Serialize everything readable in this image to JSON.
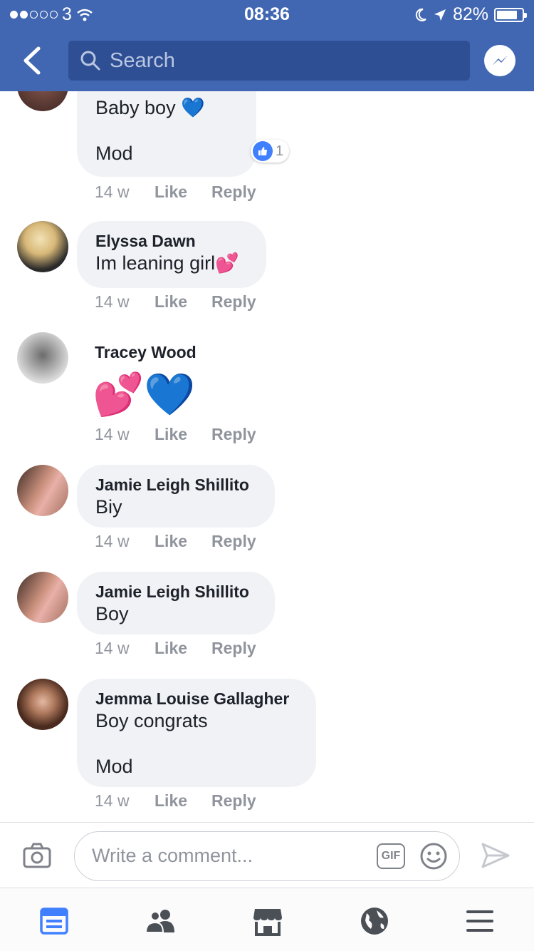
{
  "status_bar": {
    "carrier": "3",
    "time": "08:36",
    "battery": "82%",
    "battery_level": 0.82,
    "signal_bars_filled": 2,
    "signal_bars_total": 5
  },
  "header": {
    "search_placeholder": "Search",
    "accent_color": "#4267b2"
  },
  "comments": [
    {
      "name": "",
      "lines": [
        "Baby boy 💙",
        "",
        "Mod"
      ],
      "time": "14 w",
      "like_label": "Like",
      "reply_label": "Reply",
      "like_count": "1"
    },
    {
      "name": "Elyssa Dawn",
      "lines": [
        "Im leaning girl💕"
      ],
      "time": "14 w",
      "like_label": "Like",
      "reply_label": "Reply"
    },
    {
      "name": "Tracey Wood",
      "lines": [
        "💕💙"
      ],
      "time": "14 w",
      "like_label": "Like",
      "reply_label": "Reply"
    },
    {
      "name": "Jamie Leigh Shillito",
      "lines": [
        "Biy"
      ],
      "time": "14 w",
      "like_label": "Like",
      "reply_label": "Reply"
    },
    {
      "name": "Jamie Leigh Shillito",
      "lines": [
        "Boy"
      ],
      "time": "14 w",
      "like_label": "Like",
      "reply_label": "Reply"
    },
    {
      "name": "Jemma Louise Gallagher",
      "lines": [
        "Boy congrats",
        "",
        "Mod"
      ],
      "time": "14 w",
      "like_label": "Like",
      "reply_label": "Reply"
    }
  ],
  "composer": {
    "placeholder": "Write a comment...",
    "gif_label": "GIF"
  },
  "bottom_nav": {
    "items": [
      "news-feed-icon",
      "friends-icon",
      "marketplace-icon",
      "notifications-globe-icon",
      "menu-icon"
    ],
    "active_color": "#4080ff"
  }
}
